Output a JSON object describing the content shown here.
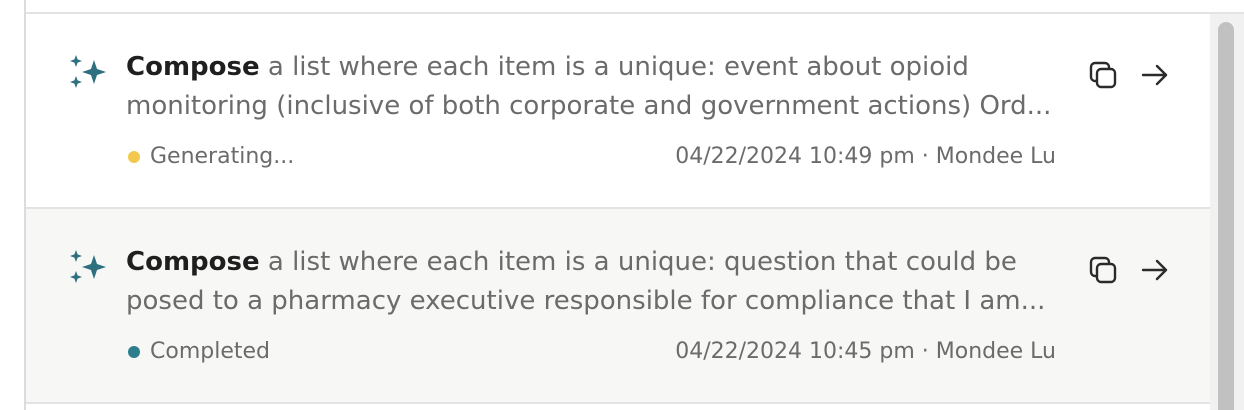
{
  "items": [
    {
      "verb": "Compose",
      "line1_rest": " a list where each item is a unique: event about opioid",
      "line2": "monitoring (inclusive of both corporate and government actions) Ord...",
      "status": "Generating...",
      "status_color": "#f2c94c",
      "meta": "04/22/2024 10:49 pm · Mondee Lu"
    },
    {
      "verb": "Compose",
      "line1_rest": " a list where each item is a unique: question that could be",
      "line2": "posed to a pharmacy executive responsible for compliance that I am...",
      "status": "Completed",
      "status_color": "#2e7d8c",
      "meta": "04/22/2024 10:45 pm · Mondee Lu"
    }
  ],
  "icons": {
    "sparkle": "sparkles-icon",
    "copy": "copy-icon",
    "open": "arrow-right-icon"
  },
  "colors": {
    "sparkle": "#2e6f80",
    "text_muted": "#6b6b6b",
    "text_strong": "#1f1f1f"
  }
}
